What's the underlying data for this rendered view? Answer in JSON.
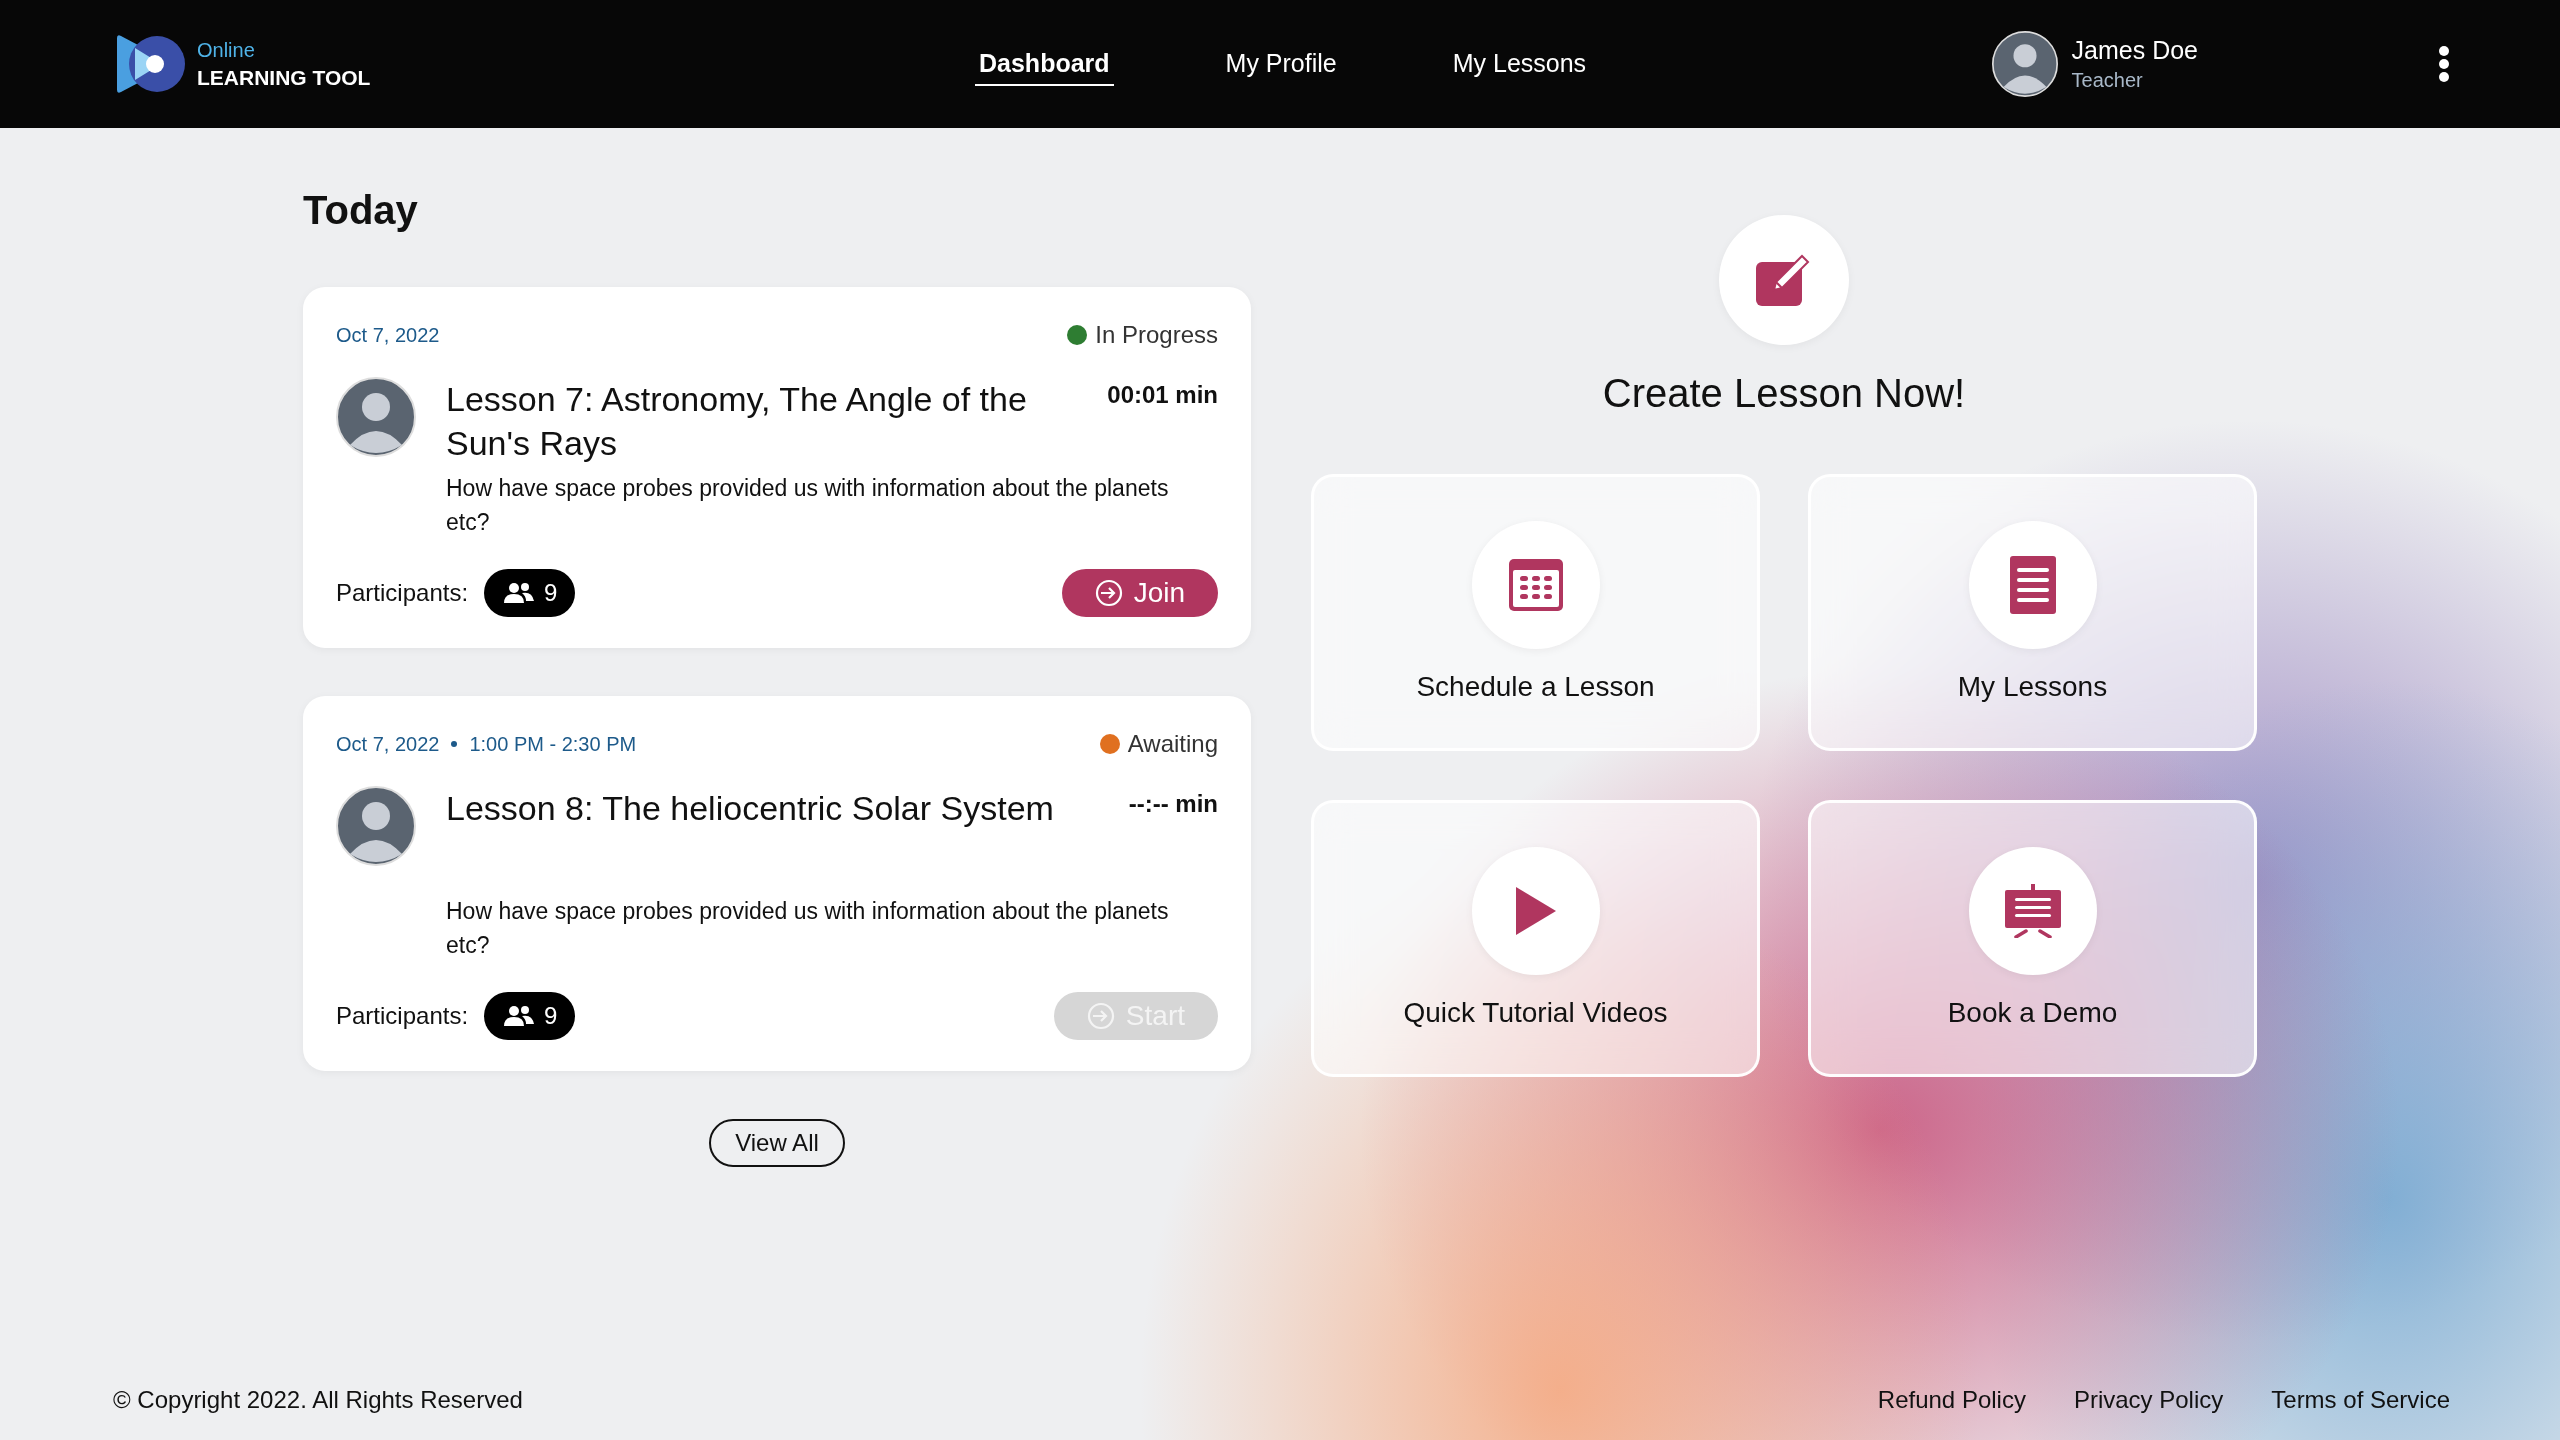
{
  "logo": {
    "line1": "Online",
    "line2": "LEARNING TOOL"
  },
  "nav": [
    {
      "label": "Dashboard",
      "selected": true
    },
    {
      "label": "My Profile",
      "selected": false
    },
    {
      "label": "My Lessons",
      "selected": false
    }
  ],
  "user": {
    "name": "James Doe",
    "role": "Teacher"
  },
  "section_title": "Today",
  "lessons": [
    {
      "date": "Oct 7, 2022",
      "status": "In Progress",
      "color": "#2e7d32",
      "title": "Lesson 7: Astronomy, The Angle of the Sun's Rays",
      "duration": "00:01 min",
      "description": "How have space probes provided us with information about the planets etc?",
      "participants_label": "Participants:",
      "participants": "9",
      "action": "Join",
      "action_disabled": false
    },
    {
      "date": "Oct 7, 2022",
      "time": "1:00 PM - 2:30 PM",
      "status": "Awaiting",
      "color": "#e07020",
      "title": "Lesson 8: The heliocentric Solar System",
      "duration": "--:-- min",
      "description": "How have space probes provided us with information about the planets etc?",
      "participants_label": "Participants:",
      "participants": "9",
      "action": "Start",
      "action_disabled": true
    }
  ],
  "view_all": "View All",
  "create": {
    "title": "Create Lesson Now!"
  },
  "tiles": [
    {
      "label": "Schedule a Lesson",
      "kind": "calendar"
    },
    {
      "label": "My Lessons",
      "kind": "document"
    },
    {
      "label": "Quick Tutorial Videos",
      "kind": "play"
    },
    {
      "label": "Book a Demo",
      "kind": "presentation"
    }
  ],
  "footer": {
    "copyright": "© Copyright 2022. All Rights Reserved",
    "links": [
      "Refund Policy",
      "Privacy Policy",
      "Terms of Service"
    ]
  }
}
